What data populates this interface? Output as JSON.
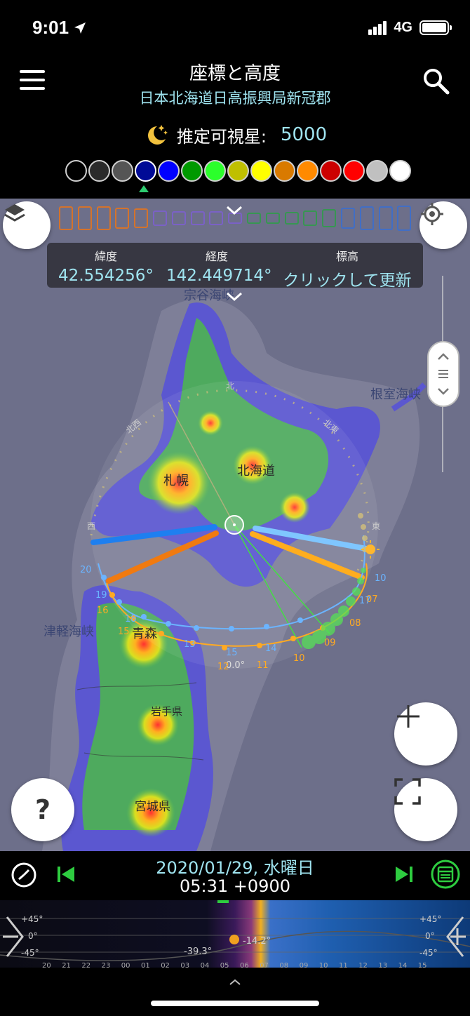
{
  "status_bar": {
    "time": "9:01",
    "network": "4G"
  },
  "header": {
    "title": "座標と高度",
    "location": "日本北海道日高振興局新冠郡",
    "stars_label": "推定可視星:",
    "stars_value": "5000"
  },
  "color_swatches": [
    {
      "color": "#000000"
    },
    {
      "color": "#2a2a2a"
    },
    {
      "color": "#555555"
    },
    {
      "color": "#000a96"
    },
    {
      "color": "#0000ff"
    },
    {
      "color": "#009900"
    },
    {
      "color": "#2bff2b"
    },
    {
      "color": "#bfbf00"
    },
    {
      "color": "#ffff00"
    },
    {
      "color": "#d97a00"
    },
    {
      "color": "#ff8a00"
    },
    {
      "color": "#cc0000"
    },
    {
      "color": "#ff0000"
    },
    {
      "color": "#c0c0c0"
    },
    {
      "color": "#ffffff"
    }
  ],
  "selected_swatch_index": 3,
  "coords": {
    "lat_label": "緯度",
    "lat_value": "42.554256°",
    "lon_label": "経度",
    "lon_value": "142.449714°",
    "elev_label": "標高",
    "elev_value": "クリックして更新"
  },
  "map_labels": {
    "soya": "宗谷海峡",
    "nemuro": "根室海峡",
    "hokkaido": "北海道",
    "sapporo": "札幌",
    "tsugaru": "津軽海峡",
    "aomori": "青森",
    "iwate": "岩手県",
    "miyagi": "宮城県",
    "north": "北",
    "northwest": "北西",
    "northeast": "北東",
    "west": "西",
    "east": "東",
    "altitude": "0.0°"
  },
  "sun_path_hours": [
    "20",
    "19",
    "16",
    "15",
    "14",
    "13",
    "12",
    "11",
    "10",
    "09",
    "08",
    "07",
    "10"
  ],
  "moon_path_hours": [
    "14",
    "15",
    "18",
    "17"
  ],
  "buttons": {
    "help": "?"
  },
  "bottom": {
    "date": "2020/01/29, 水曜日",
    "time": "05:31 +0900"
  },
  "timeline": {
    "hours": [
      "20",
      "21",
      "22",
      "23",
      "00",
      "01",
      "02",
      "03",
      "04",
      "05",
      "06",
      "07",
      "08",
      "09",
      "10",
      "11",
      "12",
      "13",
      "14",
      "15"
    ],
    "alt_labels": [
      "+45°",
      "0°",
      "-45°"
    ],
    "moon_alt": "-39.3°",
    "sun_alt": "-14.2°"
  }
}
